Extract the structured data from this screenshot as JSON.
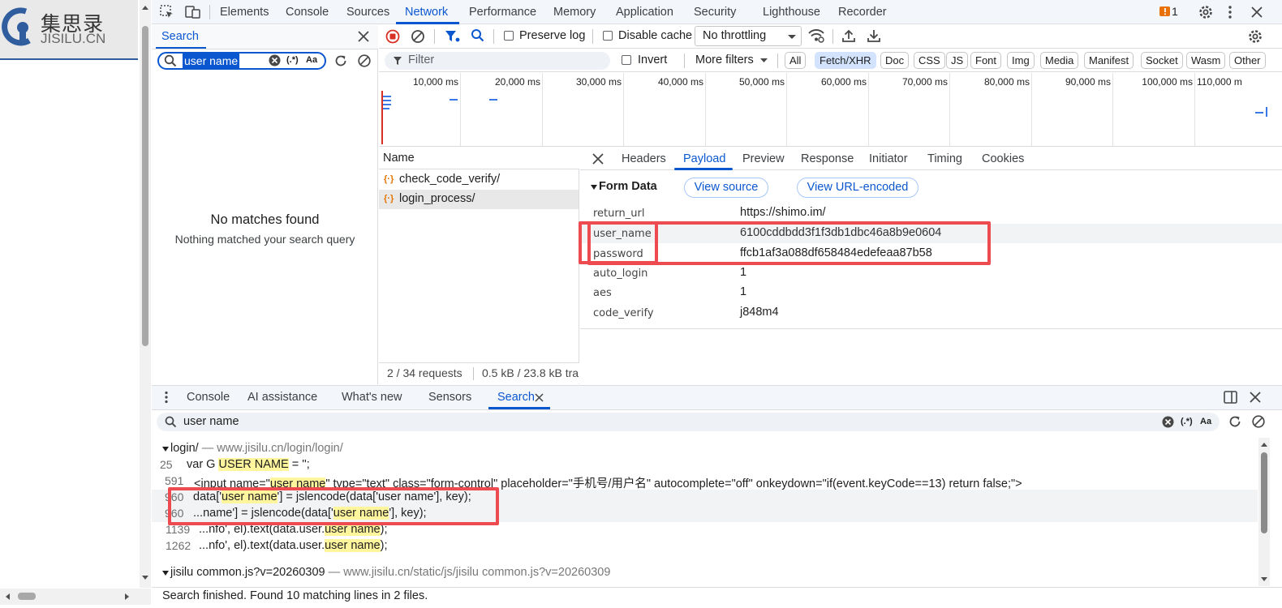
{
  "page": {
    "logo_cn": "集思录",
    "logo_en": "JISILU.CN"
  },
  "devtools": {
    "main_tabs": [
      "Elements",
      "Console",
      "Sources",
      "Network",
      "Performance",
      "Memory",
      "Application",
      "Security",
      "Lighthouse",
      "Recorder"
    ],
    "active_tab": "Network",
    "issues_count": "1"
  },
  "search_panel": {
    "tab_label": "Search",
    "query": "user name",
    "regex_label": "(.*)",
    "case_label": "Aa",
    "no_match_title": "No matches found",
    "no_match_sub": "Nothing matched your search query"
  },
  "network_toolbar": {
    "preserve_log": "Preserve log",
    "disable_cache": "Disable cache",
    "throttling": "No throttling",
    "filter_placeholder": "Filter",
    "invert": "Invert",
    "more_filters": "More filters",
    "type_filters": [
      "All",
      "Fetch/XHR",
      "Doc",
      "CSS",
      "JS",
      "Font",
      "Img",
      "Media",
      "Manifest",
      "Socket",
      "Wasm",
      "Other"
    ],
    "selected_filter": "Fetch/XHR"
  },
  "overview": {
    "ticks": [
      "10,000 ms",
      "20,000 ms",
      "30,000 ms",
      "40,000 ms",
      "50,000 ms",
      "60,000 ms",
      "70,000 ms",
      "80,000 ms",
      "90,000 ms",
      "100,000 ms",
      "110,000 m"
    ]
  },
  "requests": {
    "header": "Name",
    "items": [
      "check_code_verify/",
      "login_process/"
    ],
    "status": "2 / 34 requests",
    "transfer": "0.5 kB / 23.8 kB tra"
  },
  "detail": {
    "tabs": [
      "Headers",
      "Payload",
      "Preview",
      "Response",
      "Initiator",
      "Timing",
      "Cookies"
    ],
    "active_tab": "Payload",
    "section_title": "Form Data",
    "view_source": "View source",
    "view_url_encoded": "View URL-encoded",
    "form_data": [
      {
        "key": "return_url",
        "value": "https://shimo.im/"
      },
      {
        "key": "user_name",
        "value": "6100cddbdd3f1f3db1dbc46a8b9e0604"
      },
      {
        "key": "password",
        "value": "ffcb1af3a088df658484edefeaa87b58"
      },
      {
        "key": "auto_login",
        "value": "1"
      },
      {
        "key": "aes",
        "value": "1"
      },
      {
        "key": "code_verify",
        "value": "j848m4"
      }
    ]
  },
  "drawer": {
    "tabs": [
      "Console",
      "AI assistance",
      "What's new",
      "Sensors",
      "Search"
    ],
    "active_tab": "Search",
    "query": "user name",
    "regex_label": "(.*)",
    "case_label": "Aa",
    "results": [
      {
        "file": "login/",
        "url": "www.jisilu.cn/login/login/",
        "lines": [
          {
            "num": "25",
            "pre": "var G ",
            "match": "USER NAME",
            "post": " = '';"
          },
          {
            "num": "591",
            "pre": "<input name=\"",
            "match": "user name",
            "post": "\" type=\"text\" class=\"form-control\" placeholder=\"手机号/用户名\" autocomplete=\"off\" onkeydown=\"if(event.keyCode==13) return false;\">"
          },
          {
            "num": "960",
            "pre": "data['",
            "match": "user name",
            "post": "'] = jslencode(data['user name'], key);"
          },
          {
            "num": "960",
            "pre": "...name'] = jslencode(data['",
            "match": "user name",
            "post": "'], key);"
          },
          {
            "num": "1139",
            "pre": "...nfo', el).text(data.user.",
            "match": "user name",
            "post": ");"
          },
          {
            "num": "1262",
            "pre": "...nfo', el).text(data.user.",
            "match": "user name",
            "post": ");"
          }
        ]
      },
      {
        "file": "jisilu common.js?v=20260309",
        "url": "www.jisilu.cn/static/js/jisilu common.js?v=20260309",
        "lines": []
      }
    ],
    "status": "Search finished.  Found 10 matching lines in 2 files."
  }
}
